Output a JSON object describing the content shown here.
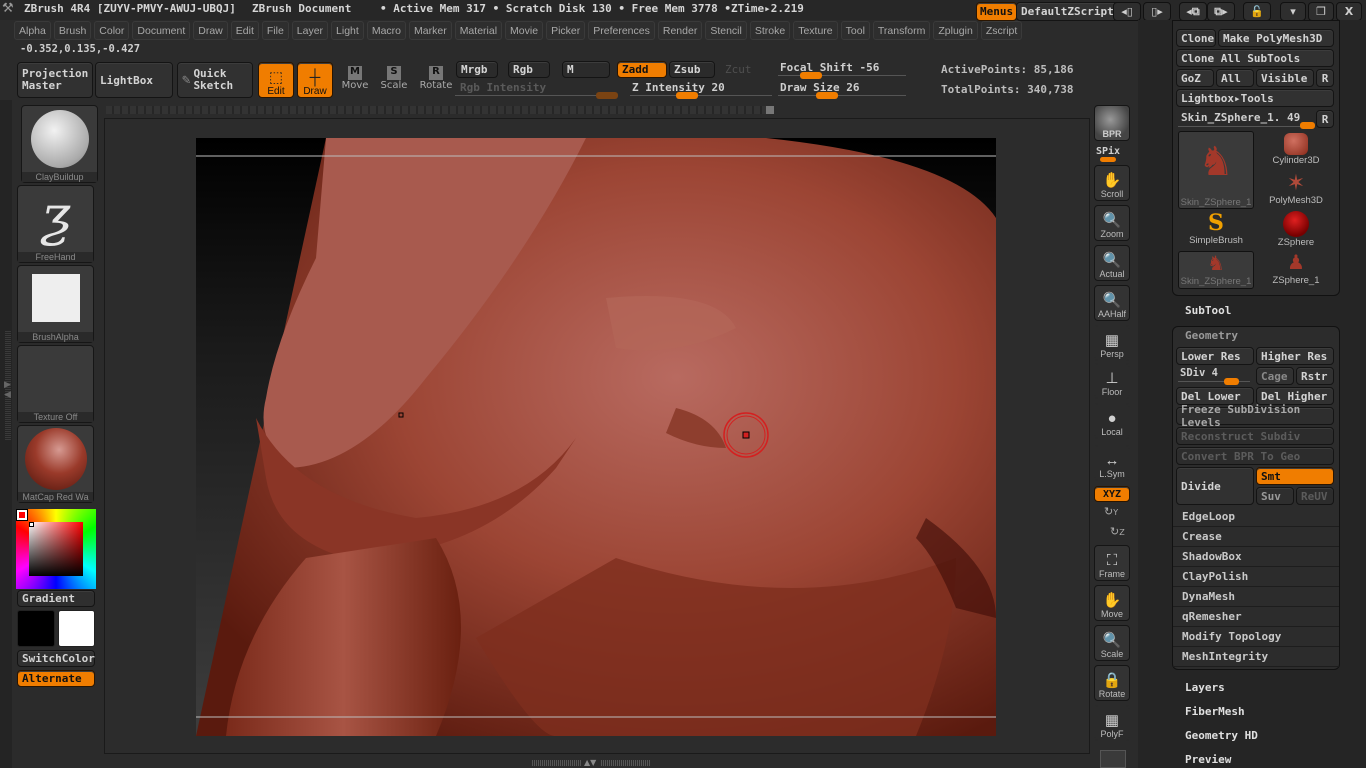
{
  "title_bar": {
    "app_title": "ZBrush 4R4 [ZUYV-PMVY-AWUJ-UBQJ]",
    "document": "ZBrush Document",
    "status": "• Active Mem 317 • Scratch Disk 130 • Free Mem 3778 •ZTime▸2.219",
    "menus_button": "Menus",
    "zscript_button": "DefaultZScript",
    "window_controls": {
      "minimize": "▾",
      "restore": "❐",
      "close": "X"
    }
  },
  "menu_bar": [
    "Alpha",
    "Brush",
    "Color",
    "Document",
    "Draw",
    "Edit",
    "File",
    "Layer",
    "Light",
    "Macro",
    "Marker",
    "Material",
    "Movie",
    "Picker",
    "Preferences",
    "Render",
    "Stencil",
    "Stroke",
    "Texture",
    "Tool",
    "Transform",
    "Zplugin",
    "Zscript"
  ],
  "coordinates": "-0.352,0.135,-0.427",
  "top_shelf": {
    "projection_master": "Projection Master",
    "lightbox": "LightBox",
    "quick_sketch": "Quick Sketch",
    "edit": "Edit",
    "draw": "Draw",
    "move": "Move",
    "scale": "Scale",
    "rotate": "Rotate",
    "mrgb": "Mrgb",
    "rgb": "Rgb",
    "m": "M",
    "zadd": "Zadd",
    "zsub": "Zsub",
    "zcut": "Zcut",
    "rgb_intensity": "Rgb Intensity",
    "z_intensity_label": "Z Intensity",
    "z_intensity": 20,
    "focal_shift_label": "Focal Shift",
    "focal_shift": -56,
    "draw_size_label": "Draw Size",
    "draw_size": 26,
    "active_points": "ActivePoints: 85,186",
    "total_points": "TotalPoints: 340,738"
  },
  "left_shelf": {
    "brush": "ClayBuildup",
    "stroke": "FreeHand",
    "alpha": "BrushAlpha",
    "texture": "Texture Off",
    "material": "MatCap Red Wa",
    "gradient": "Gradient",
    "switch_color": "SwitchColor",
    "alternate": "Alternate",
    "main_color": "#ff0000",
    "secondary_color": "#000000",
    "tertiary_color": "#ffffff"
  },
  "right_shelf": [
    "BPR",
    "SPix",
    "Scroll",
    "Zoom",
    "Actual",
    "AAHalf",
    "Persp",
    "Floor",
    "Local",
    "L.Sym",
    "XYZ",
    "Y",
    "Z",
    "Frame",
    "Move",
    "Scale",
    "Rotate",
    "PolyF"
  ],
  "tool_palette": {
    "clone": "Clone",
    "make_polymesh": "Make PolyMesh3D",
    "clone_all": "Clone All SubTools",
    "goz": "GoZ",
    "all": "All",
    "visible": "Visible",
    "r": "R",
    "lightbox_tools": "Lightbox▸Tools",
    "current_tool": "Skin_ZSphere_1. 49",
    "tools": [
      "Skin_ZSphere_1",
      "Cylinder3D",
      "PolyMesh3D",
      "SimpleBrush",
      "ZSphere",
      "Skin_ZSphere_1",
      "ZSphere_1"
    ],
    "subtool": "SubTool",
    "geometry": {
      "title": "Geometry",
      "lower_res": "Lower Res",
      "higher_res": "Higher Res",
      "sdiv": "SDiv 4",
      "cage": "Cage",
      "rstr": "Rstr",
      "del_lower": "Del Lower",
      "del_higher": "Del Higher",
      "freeze": "Freeze SubDivision Levels",
      "reconstruct": "Reconstruct Subdiv",
      "convert_bpr": "Convert BPR To Geo",
      "divide": "Divide",
      "smt": "Smt",
      "suv": "Suv",
      "reuv": "ReUV",
      "subpanels": [
        "EdgeLoop",
        "Crease",
        "ShadowBox",
        "ClayPolish",
        "DynaMesh",
        "qRemesher",
        "Modify Topology",
        "MeshIntegrity"
      ]
    },
    "sections": [
      "Layers",
      "FiberMesh",
      "Geometry HD",
      "Preview"
    ]
  }
}
